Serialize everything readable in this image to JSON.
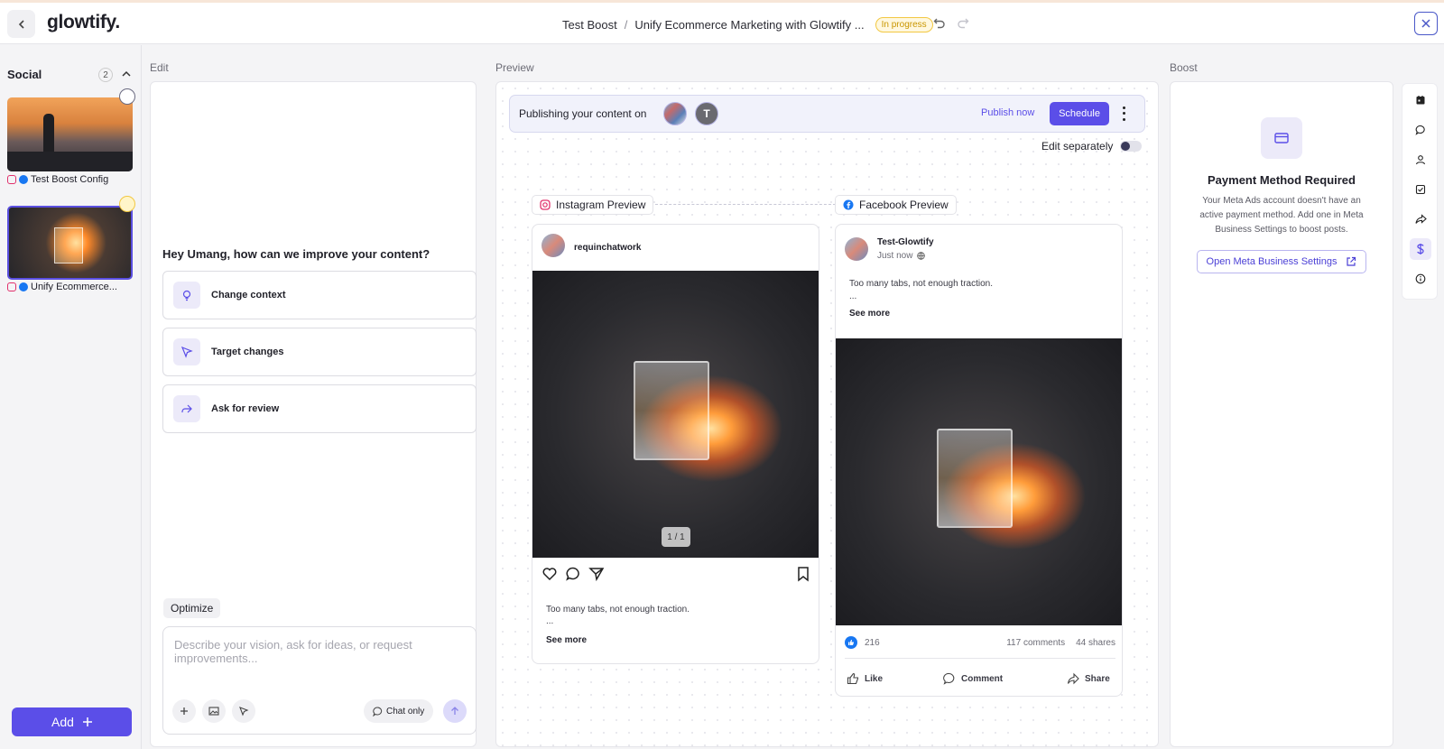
{
  "header": {
    "logo": "glowtify.",
    "breadcrumb_parent": "Test Boost",
    "breadcrumb_separator": "/",
    "breadcrumb_current": "Unify Ecommerce Marketing with Glowtify ...",
    "status": "In progress"
  },
  "sidebar": {
    "title": "Social",
    "count": "2",
    "items": [
      {
        "label": "Test Boost Config"
      },
      {
        "label": "Unify Ecommerce..."
      }
    ],
    "add_label": "Add"
  },
  "sections": {
    "edit": "Edit",
    "preview": "Preview",
    "boost": "Boost"
  },
  "edit": {
    "question": "Hey Umang, how can we improve your content?",
    "options": [
      {
        "label": "Change context"
      },
      {
        "label": "Target changes"
      },
      {
        "label": "Ask for review"
      }
    ],
    "optimize_label": "Optimize",
    "prompt_placeholder": "Describe your vision, ask for ideas, or request improvements...",
    "chat_only_label": "Chat only"
  },
  "preview": {
    "publishing_text": "Publishing your content on",
    "avatar_letter": "T",
    "publish_now": "Publish now",
    "schedule": "Schedule",
    "edit_separately": "Edit separately",
    "instagram": {
      "tag": "Instagram Preview",
      "account": "requinchatwork",
      "counter": "1 / 1",
      "caption": "Too many tabs, not enough traction.",
      "ellipsis": "...",
      "see_more": "See more"
    },
    "facebook": {
      "tag": "Facebook Preview",
      "account": "Test-Glowtify",
      "time": "Just now",
      "caption": "Too many tabs, not enough traction.",
      "ellipsis": "...",
      "see_more": "See more",
      "likes": "216",
      "comments": "117 comments",
      "shares": "44 shares",
      "like_label": "Like",
      "comment_label": "Comment",
      "share_label": "Share"
    }
  },
  "boost": {
    "title": "Payment Method Required",
    "description": "Your Meta Ads account doesn't have an active payment method. Add one in Meta Business Settings to boost posts.",
    "button": "Open Meta Business Settings"
  },
  "colors": {
    "accent": "#5b4ee8",
    "status_badge": "#f2c842",
    "facebook_blue": "#1877f2",
    "instagram_pink": "#e1306c"
  },
  "icons": {
    "rail": [
      "calendar-icon",
      "chat-icon",
      "user-icon",
      "checklist-icon",
      "share-icon",
      "dollar-icon",
      "info-icon"
    ]
  }
}
